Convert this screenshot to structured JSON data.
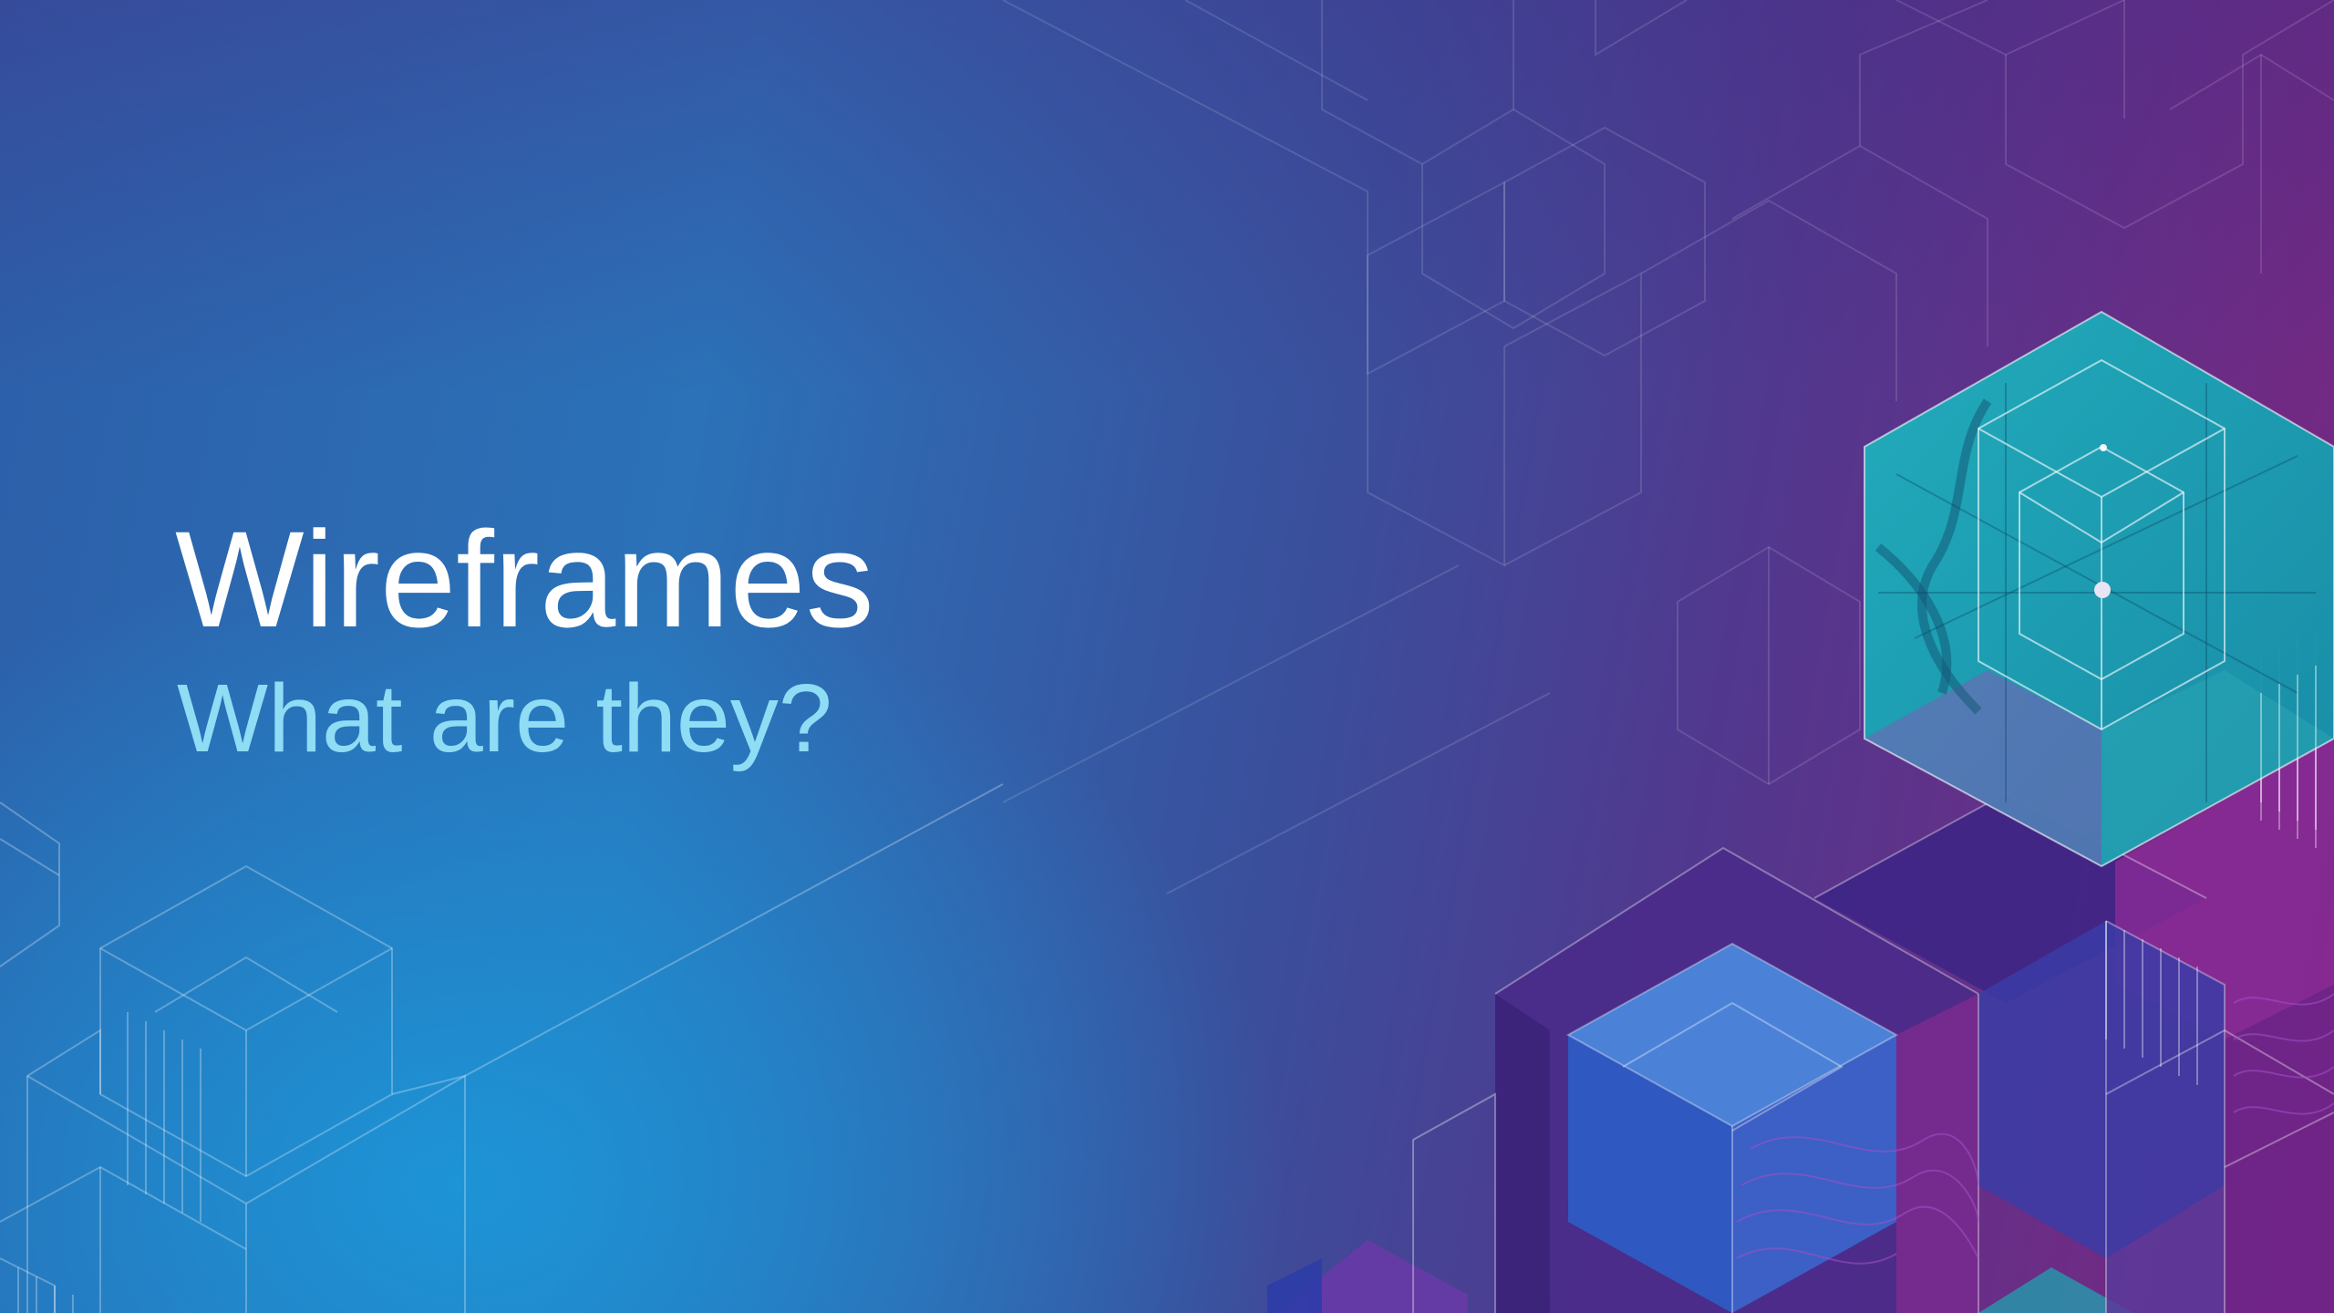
{
  "slide": {
    "title": "Wireframes",
    "subtitle": "What are they?"
  },
  "colors": {
    "title": "#ffffff",
    "subtitle": "#8fdcf5",
    "background_left": "#1c96d8",
    "background_right": "#7a2580",
    "accent_teal": "#1aa7b4"
  }
}
